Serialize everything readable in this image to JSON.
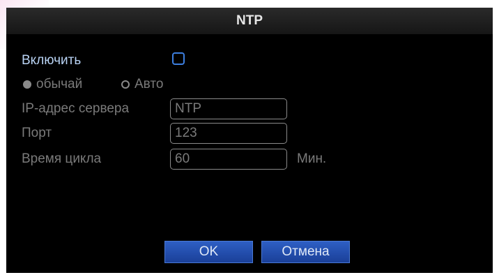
{
  "dialog": {
    "title": "NTP",
    "enable_label": "Включить",
    "enable_checked": false,
    "mode": {
      "custom_label": "обычай",
      "auto_label": "Авто",
      "selected": "custom"
    },
    "server": {
      "label": "IP-адрес сервера",
      "value": "NTP"
    },
    "port": {
      "label": "Порт",
      "value": "123"
    },
    "cycle": {
      "label": "Время цикла",
      "value": "60",
      "unit": "Мин."
    },
    "buttons": {
      "ok": "OK",
      "cancel": "Отмена"
    }
  },
  "colors": {
    "accent": "#3d7fe0",
    "active_label": "#b9d3f4",
    "inactive_text": "#7a7a7a",
    "button_bg": "#1f4aae"
  }
}
